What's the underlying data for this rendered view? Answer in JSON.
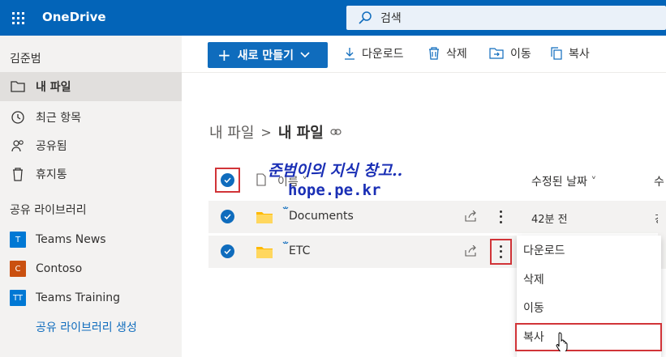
{
  "header": {
    "app_title": "OneDrive",
    "search_placeholder": "검색"
  },
  "sidebar": {
    "user": "김준범",
    "items": [
      {
        "label": "내 파일",
        "icon": "folder-icon",
        "active": true
      },
      {
        "label": "최근 항목",
        "icon": "clock-icon",
        "active": false
      },
      {
        "label": "공유됨",
        "icon": "people-icon",
        "active": false
      },
      {
        "label": "휴지통",
        "icon": "trash-icon",
        "active": false
      }
    ],
    "section_title": "공유 라이브러리",
    "libraries": [
      {
        "badge": "T",
        "label": "Teams News",
        "color": "#0078d4"
      },
      {
        "badge": "C",
        "label": "Contoso",
        "color": "#ca5010"
      },
      {
        "badge": "TT",
        "label": "Teams Training",
        "color": "#0078d4"
      }
    ],
    "create_library": "공유 라이브러리 생성"
  },
  "commandbar": {
    "new_label": "새로 만들기",
    "download": "다운로드",
    "delete": "삭제",
    "move": "이동",
    "copy": "복사"
  },
  "breadcrumb": {
    "parent": "내 파일",
    "current": "내 파일"
  },
  "list": {
    "col_name": "이름",
    "col_modified": "수정된 날짜",
    "col_next": "수",
    "rows": [
      {
        "name": "Documents",
        "modified": "42분 전",
        "extra": "강"
      },
      {
        "name": "ETC",
        "modified": "",
        "extra": ""
      }
    ]
  },
  "watermark": {
    "line1": "준범이의 지식 창고..",
    "line2": "hope.pe.kr"
  },
  "context_menu": {
    "items": [
      "다운로드",
      "삭제",
      "이동",
      "복사"
    ]
  }
}
